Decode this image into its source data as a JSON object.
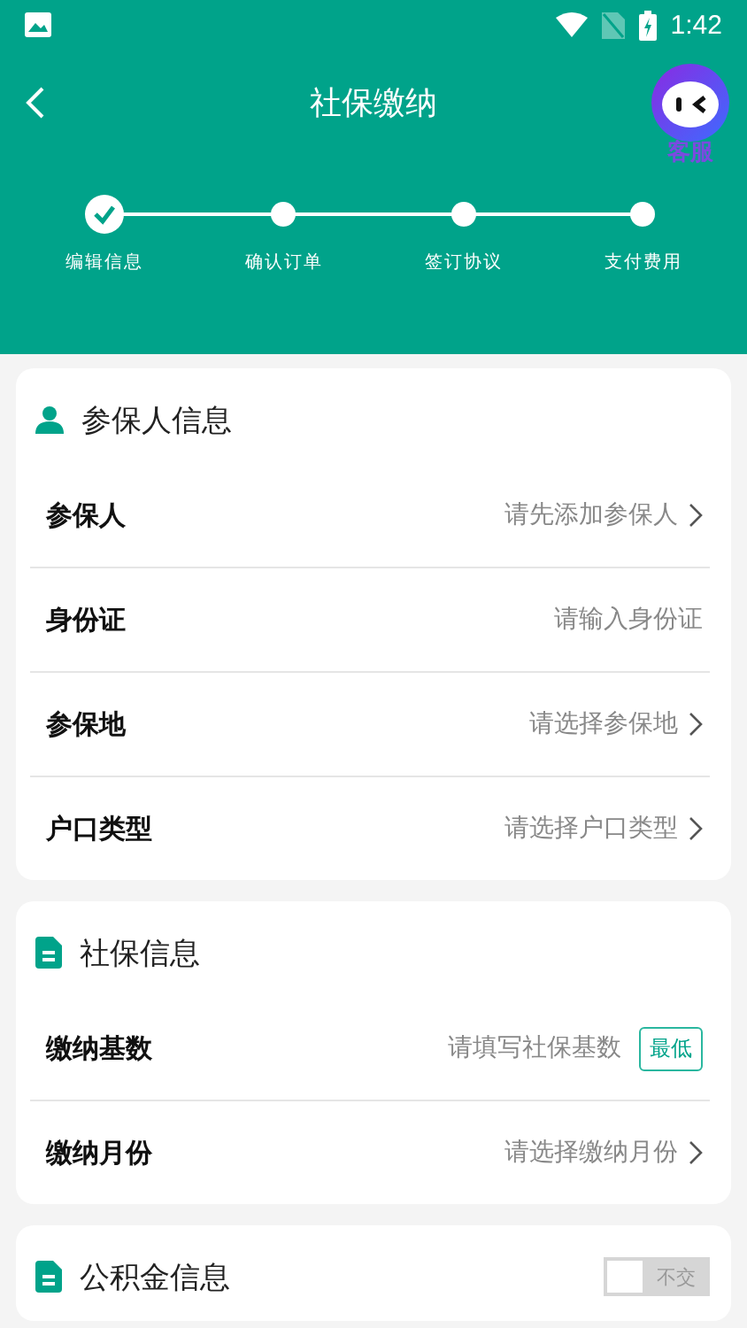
{
  "status_bar": {
    "time": "1:42"
  },
  "header": {
    "title": "社保缴纳",
    "service_label": "客服"
  },
  "steps": [
    {
      "label": "编辑信息",
      "done": true
    },
    {
      "label": "确认订单",
      "done": false
    },
    {
      "label": "签订协议",
      "done": false
    },
    {
      "label": "支付费用",
      "done": false
    }
  ],
  "sections": [
    {
      "title": "参保人信息",
      "rows": [
        {
          "label": "参保人",
          "placeholder": "请先添加参保人",
          "kind": "select"
        },
        {
          "label": "身份证",
          "placeholder": "请输入身份证",
          "kind": "input"
        },
        {
          "label": "参保地",
          "placeholder": "请选择参保地",
          "kind": "select"
        },
        {
          "label": "户口类型",
          "placeholder": "请选择户口类型",
          "kind": "select"
        }
      ]
    },
    {
      "title": "社保信息",
      "rows": [
        {
          "label": "缴纳基数",
          "placeholder": "请填写社保基数",
          "kind": "input_button",
          "button": "最低"
        },
        {
          "label": "缴纳月份",
          "placeholder": "请选择缴纳月份",
          "kind": "select"
        }
      ]
    },
    {
      "title": "公积金信息",
      "toggle": {
        "on": false,
        "label": "不交"
      }
    }
  ]
}
